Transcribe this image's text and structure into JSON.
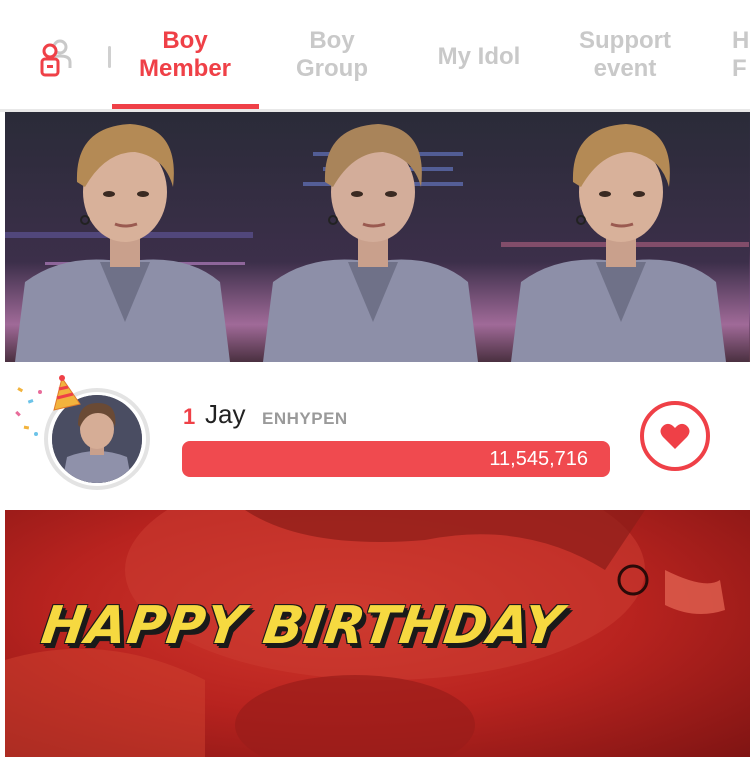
{
  "tabs": [
    {
      "line1": "Boy",
      "line2": "Member",
      "active": true
    },
    {
      "line1": "Boy",
      "line2": "Group",
      "active": false
    },
    {
      "line1": "My Idol",
      "line2": "",
      "active": false
    },
    {
      "line1": "Support",
      "line2": "event",
      "active": false
    },
    {
      "line1": "H",
      "line2": "F",
      "active": false
    }
  ],
  "ranking": {
    "rank": "1",
    "name": "Jay",
    "group": "ENHYPEN",
    "votes": "11,545,716"
  },
  "birthday_banner": {
    "text": "HAPPY BIRTHDAY"
  },
  "colors": {
    "accent": "#ef4047",
    "inactive_tab": "#c9c9c9",
    "birthday_text": "#f6d940"
  },
  "icons": {
    "tab_icon": "ranking-person-icon",
    "vote_button": "heart-icon"
  }
}
